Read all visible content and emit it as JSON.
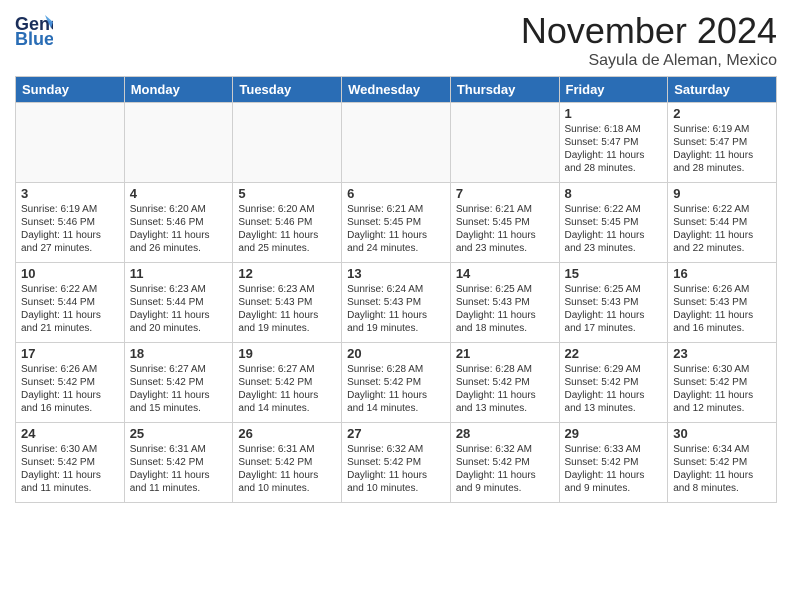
{
  "header": {
    "logo_general": "General",
    "logo_blue": "Blue",
    "month": "November 2024",
    "location": "Sayula de Aleman, Mexico"
  },
  "weekdays": [
    "Sunday",
    "Monday",
    "Tuesday",
    "Wednesday",
    "Thursday",
    "Friday",
    "Saturday"
  ],
  "weeks": [
    [
      {
        "day": "",
        "info": ""
      },
      {
        "day": "",
        "info": ""
      },
      {
        "day": "",
        "info": ""
      },
      {
        "day": "",
        "info": ""
      },
      {
        "day": "",
        "info": ""
      },
      {
        "day": "1",
        "info": "Sunrise: 6:18 AM\nSunset: 5:47 PM\nDaylight: 11 hours and 28 minutes."
      },
      {
        "day": "2",
        "info": "Sunrise: 6:19 AM\nSunset: 5:47 PM\nDaylight: 11 hours and 28 minutes."
      }
    ],
    [
      {
        "day": "3",
        "info": "Sunrise: 6:19 AM\nSunset: 5:46 PM\nDaylight: 11 hours and 27 minutes."
      },
      {
        "day": "4",
        "info": "Sunrise: 6:20 AM\nSunset: 5:46 PM\nDaylight: 11 hours and 26 minutes."
      },
      {
        "day": "5",
        "info": "Sunrise: 6:20 AM\nSunset: 5:46 PM\nDaylight: 11 hours and 25 minutes."
      },
      {
        "day": "6",
        "info": "Sunrise: 6:21 AM\nSunset: 5:45 PM\nDaylight: 11 hours and 24 minutes."
      },
      {
        "day": "7",
        "info": "Sunrise: 6:21 AM\nSunset: 5:45 PM\nDaylight: 11 hours and 23 minutes."
      },
      {
        "day": "8",
        "info": "Sunrise: 6:22 AM\nSunset: 5:45 PM\nDaylight: 11 hours and 23 minutes."
      },
      {
        "day": "9",
        "info": "Sunrise: 6:22 AM\nSunset: 5:44 PM\nDaylight: 11 hours and 22 minutes."
      }
    ],
    [
      {
        "day": "10",
        "info": "Sunrise: 6:22 AM\nSunset: 5:44 PM\nDaylight: 11 hours and 21 minutes."
      },
      {
        "day": "11",
        "info": "Sunrise: 6:23 AM\nSunset: 5:44 PM\nDaylight: 11 hours and 20 minutes."
      },
      {
        "day": "12",
        "info": "Sunrise: 6:23 AM\nSunset: 5:43 PM\nDaylight: 11 hours and 19 minutes."
      },
      {
        "day": "13",
        "info": "Sunrise: 6:24 AM\nSunset: 5:43 PM\nDaylight: 11 hours and 19 minutes."
      },
      {
        "day": "14",
        "info": "Sunrise: 6:25 AM\nSunset: 5:43 PM\nDaylight: 11 hours and 18 minutes."
      },
      {
        "day": "15",
        "info": "Sunrise: 6:25 AM\nSunset: 5:43 PM\nDaylight: 11 hours and 17 minutes."
      },
      {
        "day": "16",
        "info": "Sunrise: 6:26 AM\nSunset: 5:43 PM\nDaylight: 11 hours and 16 minutes."
      }
    ],
    [
      {
        "day": "17",
        "info": "Sunrise: 6:26 AM\nSunset: 5:42 PM\nDaylight: 11 hours and 16 minutes."
      },
      {
        "day": "18",
        "info": "Sunrise: 6:27 AM\nSunset: 5:42 PM\nDaylight: 11 hours and 15 minutes."
      },
      {
        "day": "19",
        "info": "Sunrise: 6:27 AM\nSunset: 5:42 PM\nDaylight: 11 hours and 14 minutes."
      },
      {
        "day": "20",
        "info": "Sunrise: 6:28 AM\nSunset: 5:42 PM\nDaylight: 11 hours and 14 minutes."
      },
      {
        "day": "21",
        "info": "Sunrise: 6:28 AM\nSunset: 5:42 PM\nDaylight: 11 hours and 13 minutes."
      },
      {
        "day": "22",
        "info": "Sunrise: 6:29 AM\nSunset: 5:42 PM\nDaylight: 11 hours and 13 minutes."
      },
      {
        "day": "23",
        "info": "Sunrise: 6:30 AM\nSunset: 5:42 PM\nDaylight: 11 hours and 12 minutes."
      }
    ],
    [
      {
        "day": "24",
        "info": "Sunrise: 6:30 AM\nSunset: 5:42 PM\nDaylight: 11 hours and 11 minutes."
      },
      {
        "day": "25",
        "info": "Sunrise: 6:31 AM\nSunset: 5:42 PM\nDaylight: 11 hours and 11 minutes."
      },
      {
        "day": "26",
        "info": "Sunrise: 6:31 AM\nSunset: 5:42 PM\nDaylight: 11 hours and 10 minutes."
      },
      {
        "day": "27",
        "info": "Sunrise: 6:32 AM\nSunset: 5:42 PM\nDaylight: 11 hours and 10 minutes."
      },
      {
        "day": "28",
        "info": "Sunrise: 6:32 AM\nSunset: 5:42 PM\nDaylight: 11 hours and 9 minutes."
      },
      {
        "day": "29",
        "info": "Sunrise: 6:33 AM\nSunset: 5:42 PM\nDaylight: 11 hours and 9 minutes."
      },
      {
        "day": "30",
        "info": "Sunrise: 6:34 AM\nSunset: 5:42 PM\nDaylight: 11 hours and 8 minutes."
      }
    ]
  ]
}
